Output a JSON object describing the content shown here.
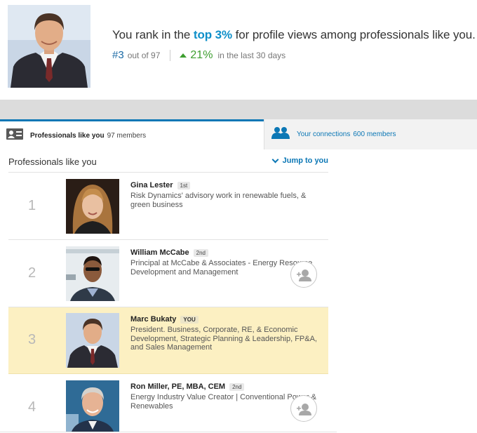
{
  "header": {
    "headline_pre": "You rank in the ",
    "headline_highlight": "top 3%",
    "headline_post": " for profile views among professionals like you.",
    "rank": "#3",
    "rank_total": "out of 97",
    "change_pct": "21%",
    "change_period": "in the last 30 days",
    "up_color": "#3d9e2f",
    "highlight_color": "#0e8fc9"
  },
  "tabs": [
    {
      "label": "Professionals like you",
      "count": "97 members",
      "icon": "profile-card-icon",
      "active": true
    },
    {
      "label": "Your connections",
      "count": "600 members",
      "icon": "connections-icon",
      "active": false
    }
  ],
  "list": {
    "title": "Professionals like you",
    "jump_label": "Jump to you",
    "rows": [
      {
        "rank": "1",
        "name": "Gina Lester",
        "degree": "1st",
        "headline": "Risk Dynamics' advisory work in renewable fuels, & green business",
        "avatar": "woman-photo",
        "connect": false
      },
      {
        "rank": "2",
        "name": "William McCabe",
        "degree": "2nd",
        "headline": "Principal at McCabe & Associates - Energy Resource Development and Management",
        "avatar": "man-photo",
        "connect": true
      },
      {
        "rank": "3",
        "name": "Marc Bukaty",
        "degree": "YOU",
        "headline": "President. Business, Corporate, RE, & Economic Development, Strategic Planning & Leadership, FP&A, and Sales Management",
        "avatar": "man-photo",
        "connect": false
      },
      {
        "rank": "4",
        "name": "Ron Miller, PE, MBA, CEM",
        "degree": "2nd",
        "headline": "Energy Industry Value Creator | Conventional Power & Renewables",
        "avatar": "man-photo",
        "connect": true
      }
    ]
  },
  "colors": {
    "brand_blue": "#0b77b5",
    "self_row": "#fcf0c2"
  }
}
